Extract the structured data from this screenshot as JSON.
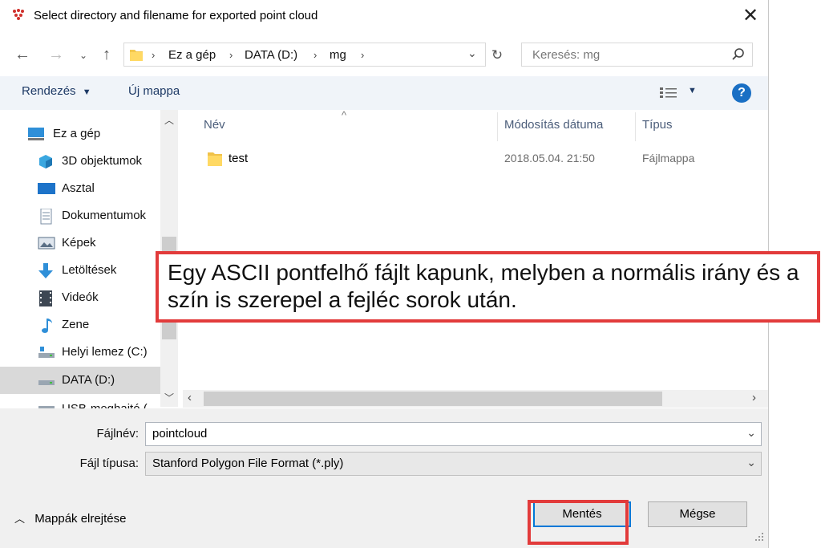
{
  "window": {
    "title": "Select directory and filename for exported point cloud"
  },
  "address": {
    "crumbs": [
      "Ez a gép",
      "DATA (D:)",
      "mg"
    ],
    "search_placeholder": "Keresés: mg"
  },
  "toolbar": {
    "organize_label": "Rendezés",
    "new_folder_label": "Új mappa"
  },
  "nav": {
    "items": [
      {
        "label": "Ez a gép",
        "icon": "pc-icon"
      },
      {
        "label": "3D objektumok",
        "icon": "cube-icon"
      },
      {
        "label": "Asztal",
        "icon": "desktop-icon"
      },
      {
        "label": "Dokumentumok",
        "icon": "document-icon"
      },
      {
        "label": "Képek",
        "icon": "pictures-icon"
      },
      {
        "label": "Letöltések",
        "icon": "download-icon"
      },
      {
        "label": "Videók",
        "icon": "video-icon"
      },
      {
        "label": "Zene",
        "icon": "music-icon"
      },
      {
        "label": "Helyi lemez (C:)",
        "icon": "drive-icon"
      },
      {
        "label": "DATA (D:)",
        "icon": "drive-icon"
      },
      {
        "label": "USB-meghajtó (",
        "icon": "usb-icon"
      }
    ]
  },
  "files": {
    "columns": [
      "Név",
      "Módosítás dátuma",
      "Típus"
    ],
    "rows": [
      {
        "name": "test",
        "date": "2018.05.04. 21:50",
        "type": "Fájlmappa"
      }
    ]
  },
  "form": {
    "filename_label": "Fájlnév:",
    "filename_value": "pointcloud",
    "filetype_label": "Fájl típusa:",
    "filetype_value": "Stanford Polygon File Format (*.ply)"
  },
  "footer": {
    "hide_folders_label": "Mappák elrejtése",
    "save_label": "Mentés",
    "cancel_label": "Mégse"
  },
  "annotation": {
    "text": "Egy ASCII pontfelhő fájlt kapunk, melyben a normális irány és a szín is szerepel a fejléc sorok után."
  },
  "colors": {
    "annotation_border": "#e23b3b",
    "help_button": "#1a6fc4",
    "selected_nav": "#d9d9d9"
  }
}
